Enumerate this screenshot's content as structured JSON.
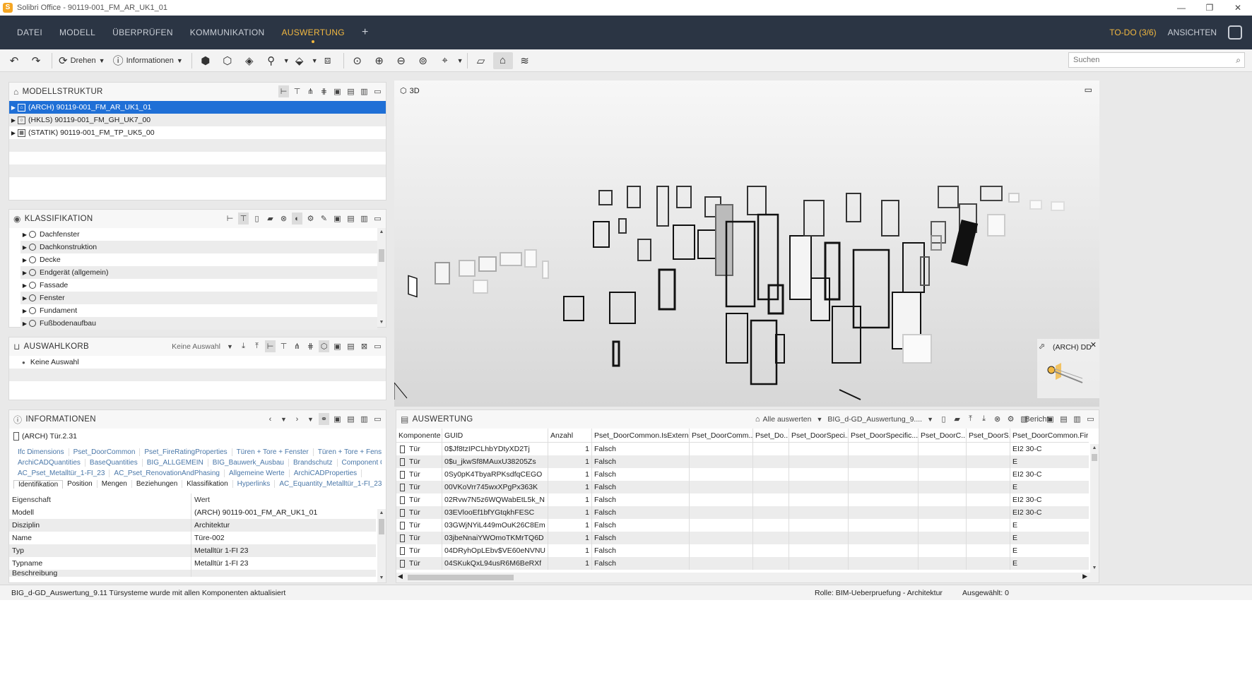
{
  "window": {
    "app_letter": "S",
    "title": "Solibri Office - 90119-001_FM_AR_UK1_01",
    "minimize": "—",
    "restore": "❐",
    "close": "✕"
  },
  "menu": {
    "items": [
      "DATEI",
      "MODELL",
      "ÜBERPRÜFEN",
      "KOMMUNIKATION",
      "AUSWERTUNG"
    ],
    "active_index": 4,
    "plus": "+",
    "todo": "TO-DO (3/6)",
    "views": "ANSICHTEN"
  },
  "toolbar": {
    "rotate_label": "Drehen",
    "info_label": "Informationen",
    "search_placeholder": "Suchen"
  },
  "modelstructure": {
    "title": "MODELLSTRUKTUR",
    "items": [
      {
        "label": "(ARCH) 90119-001_FM_AR_UK1_01",
        "selected": true
      },
      {
        "label": "(HKLS) 90119-001_FM_GH_UK7_00",
        "selected": false
      },
      {
        "label": "(STATIK) 90119-001_FM_TP_UK5_00",
        "selected": false
      }
    ]
  },
  "classification": {
    "title": "KLASSIFIKATION",
    "items": [
      "Dachfenster",
      "Dachkonstruktion",
      "Decke",
      "Endgerät (allgemein)",
      "Fassade",
      "Fenster",
      "Fundament",
      "Fußbodenaufbau"
    ]
  },
  "basket": {
    "title": "AUSWAHLKORB",
    "dropdown": "Keine Auswahl",
    "item": "Keine Auswahl"
  },
  "information": {
    "title": "INFORMATIONEN",
    "object": "(ARCH) Tür.2.31",
    "tab_rows": [
      [
        "Ifc Dimensions",
        "Pset_DoorCommon",
        "Pset_FireRatingProperties",
        "Türen + Tore + Fenster",
        "Türen + Tore + Fenster"
      ],
      [
        "ArchiCADQuantities",
        "BaseQuantities",
        "BIG_ALLGEMEIN",
        "BIG_Bauwerk_Ausbau",
        "Brandschutz",
        "Component Quantities"
      ],
      [
        "AC_Pset_Metalltür_1-FI_23",
        "AC_Pset_RenovationAndPhasing",
        "Allgemeine Werte",
        "ArchiCADProperties"
      ]
    ],
    "main_tabs": [
      "Identifikation",
      "Position",
      "Mengen",
      "Beziehungen",
      "Klassifikation",
      "Hyperlinks",
      "AC_Equantity_Metalltür_1-FI_23"
    ],
    "active_tab": 0,
    "col_key": "Eigenschaft",
    "col_value": "Wert",
    "rows": [
      {
        "k": "Modell",
        "v": "(ARCH) 90119-001_FM_AR_UK1_01"
      },
      {
        "k": "Disziplin",
        "v": "Architektur"
      },
      {
        "k": "Name",
        "v": "Türe-002"
      },
      {
        "k": "Typ",
        "v": "Metalltür 1-FI 23"
      },
      {
        "k": "Typname",
        "v": "Metalltür 1-FI 23"
      },
      {
        "k": "Beschreibung",
        "v": ""
      }
    ]
  },
  "view3d": {
    "title": "3D",
    "navcube_label": "(ARCH) DD"
  },
  "evaluation": {
    "title": "AUSWERTUNG",
    "eval_all": "Alle auswerten",
    "report_select": "BIG_d-GD_Auswertung_9....",
    "report_label": "Bericht",
    "columns": [
      "Komponente",
      "GUID",
      "Anzahl",
      "Pset_DoorCommon.IsExternal",
      "Pset_DoorComm...",
      "Pset_Do...",
      "Pset_DoorSpeci...",
      "Pset_DoorSpecific....",
      "Pset_DoorC...",
      "Pset_DoorS...",
      "Pset_DoorCommon.Firef"
    ],
    "rows": [
      {
        "comp": "Tür",
        "guid": "0$Jf8tzIPCLhbYDtyXD2Tj",
        "count": "1",
        "ext": "Falsch",
        "fire": "EI2 30-C"
      },
      {
        "comp": "Tür",
        "guid": "0$u_jkwSf8MAuxU38205Zs",
        "count": "1",
        "ext": "Falsch",
        "fire": "E"
      },
      {
        "comp": "Tür",
        "guid": "0Sy0pK4TbyaRPKsdfqCEGO",
        "count": "1",
        "ext": "Falsch",
        "fire": "EI2 30-C"
      },
      {
        "comp": "Tür",
        "guid": "00VKoVrr745wxXPgPx363K",
        "count": "1",
        "ext": "Falsch",
        "fire": "E"
      },
      {
        "comp": "Tür",
        "guid": "02Rvw7N5z6WQWabEtL5k_N",
        "count": "1",
        "ext": "Falsch",
        "fire": "EI2 30-C"
      },
      {
        "comp": "Tür",
        "guid": "03EVlooEf1bfYGtqkhFESC",
        "count": "1",
        "ext": "Falsch",
        "fire": "EI2 30-C"
      },
      {
        "comp": "Tür",
        "guid": "03GWjNYiL449mOuK26C8Em",
        "count": "1",
        "ext": "Falsch",
        "fire": "E"
      },
      {
        "comp": "Tür",
        "guid": "03jbeNnaiYWOmoTKMrTQ6D",
        "count": "1",
        "ext": "Falsch",
        "fire": "E"
      },
      {
        "comp": "Tür",
        "guid": "04DRyhOpLEbv$VE60eNVNU",
        "count": "1",
        "ext": "Falsch",
        "fire": "E"
      },
      {
        "comp": "Tür",
        "guid": "04SKukQxL94usR6M6BeRXf",
        "count": "1",
        "ext": "Falsch",
        "fire": "E"
      }
    ]
  },
  "status": {
    "message": "BIG_d-GD_Auswertung_9.11 Türsysteme wurde mit allen Komponenten aktualisiert",
    "role": "Rolle: BIM-Ueberpruefung - Architektur",
    "selected": "Ausgewählt: 0"
  },
  "colors": {
    "menubar": "#2b3544",
    "accent": "#f2b840",
    "selection": "#1f6fd6"
  }
}
